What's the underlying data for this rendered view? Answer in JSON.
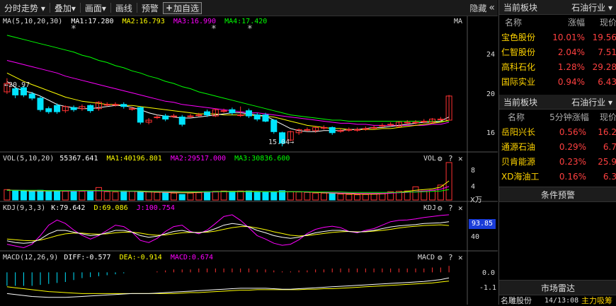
{
  "toolbar": {
    "items": [
      "分时走势 ▾",
      "叠加▾",
      "画面▾",
      "画线",
      "预警"
    ],
    "add_watch": "加自选",
    "hide_label": "隐藏",
    "hide_icon": "«"
  },
  "colors": {
    "up": "#ff3232",
    "down": "#00e4ff",
    "ma1": "#ffffff",
    "ma2": "#ffff00",
    "ma3": "#ff00ff",
    "ma4": "#00ff00"
  },
  "main_pane": {
    "legend": {
      "title": "MA(5,10,20,30)",
      "ma1": "MA1:17.280",
      "ma2": "MA2:16.793",
      "ma3": "MA3:16.990",
      "ma4": "MA4:17.420"
    },
    "corner_label": "MA",
    "high_annotation": "←20.97",
    "low_annotation": "15.04→",
    "y_ticks": [
      "24",
      "20",
      "16"
    ]
  },
  "vol_pane": {
    "legend": {
      "title": "VOL(5,10,20)",
      "vol": "55367.641",
      "ma1": "MA1:40196.801",
      "ma2": "MA2:29517.000",
      "ma3": "MA3:30836.600"
    },
    "corner_label": "VOL",
    "y_ticks": [
      "8",
      "4"
    ],
    "unit": "X万"
  },
  "kdj_pane": {
    "legend": {
      "title": "KDJ(9,3,3)",
      "k": "K:79.642",
      "d": "D:69.086",
      "j": "J:100.754"
    },
    "corner_label": "KDJ",
    "current": "93.85",
    "y_ticks": [
      "40"
    ]
  },
  "macd_pane": {
    "legend": {
      "title": "MACD(12,26,9)",
      "diff": "DIFF:-0.577",
      "dea": "DEA:-0.914",
      "macd": "MACD:0.674"
    },
    "corner_label": "MACD",
    "y_ticks": [
      "0.0",
      "-1.1"
    ]
  },
  "pane_icons": {
    "gear": "⚙",
    "help": "?",
    "close": "✕"
  },
  "chart_data": {
    "type": "candlestick",
    "candles": [
      {
        "o": 20.2,
        "c": 21.0,
        "h": 21.5,
        "l": 20.0
      },
      {
        "o": 20.5,
        "c": 19.9,
        "h": 20.7,
        "l": 19.6
      },
      {
        "o": 20.6,
        "c": 19.9,
        "h": 20.8,
        "l": 19.7
      },
      {
        "o": 20.0,
        "c": 19.6,
        "h": 20.2,
        "l": 19.4
      },
      {
        "o": 19.6,
        "c": 18.5,
        "h": 19.8,
        "l": 18.3
      },
      {
        "o": 18.6,
        "c": 18.3,
        "h": 18.8,
        "l": 18.1
      },
      {
        "o": 18.9,
        "c": 18.3,
        "h": 19.1,
        "l": 18.1
      },
      {
        "o": 18.4,
        "c": 18.8,
        "h": 18.9,
        "l": 18.2
      },
      {
        "o": 18.7,
        "c": 18.5,
        "h": 18.9,
        "l": 18.3
      },
      {
        "o": 18.6,
        "c": 18.8,
        "h": 19.0,
        "l": 18.4
      },
      {
        "o": 18.9,
        "c": 18.4,
        "h": 19.0,
        "l": 18.2
      },
      {
        "o": 18.6,
        "c": 19.2,
        "h": 19.3,
        "l": 18.4
      },
      {
        "o": 19.0,
        "c": 19.0,
        "h": 19.2,
        "l": 18.8
      },
      {
        "o": 19.0,
        "c": 19.0,
        "h": 19.2,
        "l": 18.8
      },
      {
        "o": 19.0,
        "c": 18.8,
        "h": 19.2,
        "l": 18.6
      },
      {
        "o": 18.6,
        "c": 18.6,
        "h": 18.8,
        "l": 18.4
      },
      {
        "o": 18.7,
        "c": 17.3,
        "h": 18.8,
        "l": 17.1
      },
      {
        "o": 17.3,
        "c": 17.5,
        "h": 17.7,
        "l": 17.1
      },
      {
        "o": 17.8,
        "c": 17.8,
        "h": 18.0,
        "l": 17.6
      },
      {
        "o": 17.9,
        "c": 17.6,
        "h": 18.1,
        "l": 17.4
      },
      {
        "o": 17.9,
        "c": 17.9,
        "h": 18.1,
        "l": 17.7
      },
      {
        "o": 17.8,
        "c": 17.1,
        "h": 18.0,
        "l": 16.9
      },
      {
        "o": 17.9,
        "c": 17.9,
        "h": 18.1,
        "l": 17.7
      },
      {
        "o": 18.0,
        "c": 18.0,
        "h": 18.2,
        "l": 17.8
      },
      {
        "o": 18.3,
        "c": 18.0,
        "h": 18.5,
        "l": 17.8
      },
      {
        "o": 17.9,
        "c": 18.5,
        "h": 18.6,
        "l": 17.8
      },
      {
        "o": 18.4,
        "c": 18.4,
        "h": 18.6,
        "l": 18.2
      },
      {
        "o": 18.5,
        "c": 18.2,
        "h": 18.7,
        "l": 18.0
      },
      {
        "o": 18.0,
        "c": 18.0,
        "h": 18.8,
        "l": 17.8
      },
      {
        "o": 18.4,
        "c": 17.9,
        "h": 18.6,
        "l": 17.7
      },
      {
        "o": 18.0,
        "c": 17.6,
        "h": 18.2,
        "l": 17.4
      },
      {
        "o": 18.0,
        "c": 17.4,
        "h": 18.2,
        "l": 17.3
      },
      {
        "o": 17.5,
        "c": 16.4,
        "h": 17.6,
        "l": 16.2
      },
      {
        "o": 16.3,
        "c": 15.3,
        "h": 16.4,
        "l": 15.0
      },
      {
        "o": 15.6,
        "c": 16.4,
        "h": 16.5,
        "l": 15.5
      },
      {
        "o": 16.3,
        "c": 16.6,
        "h": 16.7,
        "l": 16.1
      },
      {
        "o": 16.6,
        "c": 16.6,
        "h": 16.8,
        "l": 16.4
      },
      {
        "o": 16.5,
        "c": 16.8,
        "h": 16.9,
        "l": 16.3
      },
      {
        "o": 16.8,
        "c": 16.8,
        "h": 17.0,
        "l": 16.6
      },
      {
        "o": 16.8,
        "c": 16.3,
        "h": 16.9,
        "l": 16.1
      },
      {
        "o": 16.5,
        "c": 16.5,
        "h": 16.7,
        "l": 16.3
      },
      {
        "o": 16.6,
        "c": 16.6,
        "h": 16.8,
        "l": 16.4
      },
      {
        "o": 16.6,
        "c": 16.6,
        "h": 16.8,
        "l": 16.4
      },
      {
        "o": 16.7,
        "c": 16.7,
        "h": 16.9,
        "l": 16.5
      },
      {
        "o": 16.8,
        "c": 16.8,
        "h": 17.0,
        "l": 16.6
      },
      {
        "o": 17.0,
        "c": 17.0,
        "h": 17.2,
        "l": 16.8
      },
      {
        "o": 17.1,
        "c": 17.1,
        "h": 17.3,
        "l": 16.9
      },
      {
        "o": 16.9,
        "c": 17.3,
        "h": 17.4,
        "l": 16.8
      },
      {
        "o": 17.3,
        "c": 17.3,
        "h": 17.5,
        "l": 17.1
      },
      {
        "o": 17.3,
        "c": 17.3,
        "h": 17.5,
        "l": 17.1
      },
      {
        "o": 17.4,
        "c": 17.4,
        "h": 17.6,
        "l": 17.2
      },
      {
        "o": 17.3,
        "c": 17.6,
        "h": 17.7,
        "l": 17.2
      },
      {
        "o": 17.6,
        "c": 17.6,
        "h": 17.8,
        "l": 17.4
      },
      {
        "o": 17.5,
        "c": 19.8,
        "h": 19.9,
        "l": 17.5
      }
    ],
    "ma": {
      "ma1": [
        21.2,
        20.6,
        20.3,
        20.1,
        19.8,
        19.4,
        19.0,
        18.8,
        18.7,
        18.6,
        18.6,
        18.7,
        18.8,
        18.9,
        18.9,
        18.7,
        18.5,
        18.2,
        18.0,
        17.9,
        17.8,
        17.7,
        17.7,
        17.8,
        17.9,
        18.0,
        18.1,
        18.2,
        18.2,
        18.1,
        18.0,
        17.9,
        17.5,
        17.1,
        16.7,
        16.5,
        16.4,
        16.4,
        16.5,
        16.5,
        16.5,
        16.6,
        16.6,
        16.7,
        16.8,
        16.8,
        16.9,
        17.0,
        17.1,
        17.2,
        17.3,
        17.3,
        17.4,
        17.8
      ],
      "ma2": [
        22.0,
        21.6,
        21.2,
        20.9,
        20.6,
        20.3,
        20.0,
        19.7,
        19.5,
        19.3,
        19.2,
        19.1,
        19.0,
        19.0,
        18.9,
        18.9,
        18.8,
        18.7,
        18.6,
        18.5,
        18.4,
        18.3,
        18.2,
        18.1,
        18.1,
        18.1,
        18.0,
        18.0,
        18.0,
        18.0,
        17.9,
        17.9,
        17.8,
        17.6,
        17.4,
        17.2,
        17.0,
        16.9,
        16.8,
        16.7,
        16.7,
        16.6,
        16.6,
        16.6,
        16.6,
        16.7,
        16.7,
        16.8,
        16.9,
        17.0,
        17.1,
        17.2,
        17.3,
        17.5
      ],
      "ma3": [
        23.2,
        23.0,
        22.8,
        22.6,
        22.4,
        22.2,
        22.0,
        21.7,
        21.5,
        21.3,
        21.1,
        20.9,
        20.7,
        20.5,
        20.3,
        20.1,
        19.9,
        19.7,
        19.5,
        19.3,
        19.2,
        19.0,
        18.9,
        18.8,
        18.7,
        18.6,
        18.5,
        18.4,
        18.3,
        18.2,
        18.2,
        18.1,
        18.0,
        17.9,
        17.8,
        17.7,
        17.6,
        17.5,
        17.4,
        17.3,
        17.2,
        17.2,
        17.1,
        17.1,
        17.0,
        17.0,
        17.0,
        17.0,
        17.0,
        17.0,
        17.0,
        17.1,
        17.1,
        17.3
      ],
      "ma4": [
        25.6,
        25.4,
        25.2,
        25.0,
        24.8,
        24.6,
        24.4,
        24.2,
        24.0,
        23.7,
        23.5,
        23.2,
        23.0,
        22.7,
        22.5,
        22.2,
        22.0,
        21.7,
        21.5,
        21.2,
        21.0,
        20.7,
        20.5,
        20.2,
        20.0,
        19.8,
        19.6,
        19.4,
        19.2,
        19.0,
        18.8,
        18.6,
        18.4,
        18.2,
        18.0,
        17.9,
        17.8,
        17.7,
        17.6,
        17.5,
        17.5,
        17.4,
        17.4,
        17.4,
        17.4,
        17.4,
        17.4,
        17.4,
        17.4,
        17.4,
        17.4,
        17.4,
        17.4,
        17.4
      ]
    },
    "ylim": [
      14.6,
      26.2
    ],
    "volume": [
      3.0,
      2.8,
      2.7,
      2.6,
      2.8,
      2.4,
      2.6,
      2.5,
      2.4,
      2.5,
      2.6,
      3.6,
      2.4,
      2.3,
      2.6,
      2.5,
      2.3,
      2.5,
      2.2,
      2.1,
      2.0,
      1.6,
      2.0,
      2.1,
      2.4,
      2.5,
      2.6,
      2.5,
      2.6,
      2.6,
      2.3,
      2.4,
      2.3,
      2.7,
      2.4,
      2.3,
      2.2,
      2.0,
      2.0,
      1.8,
      1.7,
      1.6,
      1.5,
      1.6,
      1.7,
      1.8,
      2.4,
      2.5,
      2.6,
      3.8,
      2.6,
      2.8,
      4.3,
      10.8
    ],
    "vol_ma": {
      "ma1": [
        2.9,
        2.8,
        2.7,
        2.6,
        2.6,
        2.6,
        2.6,
        2.6,
        2.6,
        2.7,
        2.7,
        2.7,
        2.6,
        2.6,
        2.5,
        2.5,
        2.4,
        2.3,
        2.3,
        2.2,
        2.1,
        2.1,
        2.1,
        2.2,
        2.3,
        2.4,
        2.5,
        2.5,
        2.5,
        2.5,
        2.5,
        2.4,
        2.4,
        2.4,
        2.4,
        2.4,
        2.3,
        2.2,
        2.1,
        2.0,
        1.9,
        1.8,
        1.7,
        1.7,
        1.7,
        1.8,
        2.0,
        2.2,
        2.5,
        2.8,
        3.0,
        3.2,
        3.7,
        5.5
      ],
      "ma2": [
        2.8,
        2.8,
        2.8,
        2.7,
        2.7,
        2.7,
        2.7,
        2.6,
        2.6,
        2.6,
        2.6,
        2.6,
        2.6,
        2.6,
        2.5,
        2.5,
        2.5,
        2.4,
        2.4,
        2.3,
        2.3,
        2.3,
        2.3,
        2.3,
        2.3,
        2.3,
        2.4,
        2.4,
        2.4,
        2.4,
        2.4,
        2.4,
        2.4,
        2.4,
        2.4,
        2.4,
        2.3,
        2.3,
        2.2,
        2.1,
        2.0,
        2.0,
        1.9,
        1.9,
        1.9,
        1.9,
        2.0,
        2.1,
        2.2,
        2.4,
        2.6,
        2.8,
        3.1,
        3.9
      ],
      "ma3": [
        2.8,
        2.8,
        2.8,
        2.8,
        2.8,
        2.7,
        2.7,
        2.7,
        2.7,
        2.7,
        2.7,
        2.7,
        2.7,
        2.6,
        2.6,
        2.6,
        2.6,
        2.5,
        2.5,
        2.5,
        2.5,
        2.4,
        2.4,
        2.4,
        2.4,
        2.4,
        2.4,
        2.4,
        2.4,
        2.4,
        2.4,
        2.4,
        2.4,
        2.4,
        2.4,
        2.4,
        2.4,
        2.3,
        2.3,
        2.3,
        2.3,
        2.2,
        2.2,
        2.2,
        2.2,
        2.2,
        2.2,
        2.2,
        2.3,
        2.3,
        2.4,
        2.5,
        2.6,
        3.0
      ]
    },
    "vol_ylim": [
      0,
      11
    ],
    "kdj": {
      "k": [
        25,
        20,
        18,
        20,
        30,
        45,
        55,
        55,
        50,
        45,
        40,
        42,
        48,
        55,
        55,
        50,
        40,
        35,
        38,
        45,
        52,
        55,
        50,
        48,
        52,
        60,
        70,
        75,
        72,
        65,
        55,
        48,
        40,
        35,
        32,
        35,
        42,
        48,
        52,
        55,
        55,
        52,
        50,
        52,
        55,
        60,
        65,
        68,
        70,
        72,
        75,
        76,
        77,
        80
      ],
      "d": [
        30,
        28,
        26,
        25,
        27,
        33,
        40,
        45,
        47,
        47,
        45,
        44,
        45,
        48,
        50,
        50,
        47,
        43,
        41,
        42,
        45,
        48,
        49,
        49,
        50,
        53,
        58,
        63,
        66,
        66,
        62,
        57,
        51,
        46,
        41,
        39,
        40,
        43,
        46,
        49,
        51,
        52,
        51,
        51,
        53,
        55,
        58,
        62,
        65,
        67,
        69,
        70,
        71,
        69
      ],
      "j": [
        15,
        10,
        5,
        15,
        40,
        70,
        85,
        75,
        56,
        41,
        30,
        40,
        55,
        70,
        66,
        50,
        26,
        20,
        32,
        52,
        66,
        70,
        52,
        45,
        56,
        75,
        95,
        100,
        84,
        63,
        40,
        30,
        18,
        12,
        15,
        28,
        46,
        58,
        64,
        67,
        63,
        52,
        48,
        55,
        60,
        70,
        80,
        84,
        85,
        88,
        92,
        95,
        98,
        100
      ]
    },
    "kdj_ylim": [
      0,
      110
    ],
    "macd": {
      "diff": [
        -2.2,
        -2.3,
        -2.4,
        -2.5,
        -2.55,
        -2.6,
        -2.6,
        -2.6,
        -2.55,
        -2.5,
        -2.45,
        -2.4,
        -2.35,
        -2.3,
        -2.25,
        -2.2,
        -2.2,
        -2.2,
        -2.15,
        -2.1,
        -2.05,
        -2.0,
        -1.95,
        -1.9,
        -1.85,
        -1.8,
        -1.75,
        -1.7,
        -1.65,
        -1.65,
        -1.65,
        -1.65,
        -1.7,
        -1.75,
        -1.75,
        -1.7,
        -1.65,
        -1.6,
        -1.55,
        -1.5,
        -1.45,
        -1.4,
        -1.35,
        -1.3,
        -1.25,
        -1.2,
        -1.15,
        -1.1,
        -1.05,
        -1.0,
        -0.95,
        -0.85,
        -0.75,
        -0.58
      ],
      "dea": [
        -1.5,
        -1.6,
        -1.7,
        -1.8,
        -1.9,
        -2.0,
        -2.05,
        -2.1,
        -2.15,
        -2.2,
        -2.2,
        -2.2,
        -2.2,
        -2.2,
        -2.2,
        -2.2,
        -2.2,
        -2.2,
        -2.2,
        -2.2,
        -2.2,
        -2.15,
        -2.1,
        -2.1,
        -2.05,
        -2.0,
        -1.95,
        -1.9,
        -1.85,
        -1.85,
        -1.8,
        -1.8,
        -1.8,
        -1.8,
        -1.8,
        -1.8,
        -1.75,
        -1.75,
        -1.7,
        -1.7,
        -1.65,
        -1.6,
        -1.55,
        -1.5,
        -1.45,
        -1.4,
        -1.35,
        -1.3,
        -1.25,
        -1.2,
        -1.15,
        -1.1,
        -1.0,
        -0.91
      ],
      "hist": [
        -1.4,
        -1.4,
        -1.4,
        -1.4,
        -1.3,
        -1.2,
        -1.1,
        -1.0,
        -0.8,
        -0.6,
        -0.5,
        -0.4,
        -0.3,
        -0.2,
        -0.1,
        0.0,
        0.0,
        0.0,
        0.1,
        0.2,
        0.3,
        0.3,
        0.3,
        0.4,
        0.4,
        0.4,
        0.4,
        0.4,
        0.4,
        0.4,
        0.3,
        0.3,
        0.2,
        0.1,
        0.1,
        0.2,
        0.2,
        0.3,
        0.3,
        0.4,
        0.4,
        0.4,
        0.4,
        0.4,
        0.4,
        0.4,
        0.4,
        0.4,
        0.4,
        0.4,
        0.4,
        0.5,
        0.5,
        0.67
      ]
    },
    "macd_ylim": [
      -3.2,
      1.2
    ]
  },
  "sidebar": {
    "panel1": {
      "title": "当前板块",
      "sector": "石油行业 ▾",
      "headers": [
        "名称",
        "涨幅",
        "现价"
      ],
      "rows": [
        {
          "name": "宝色股份",
          "pct": "10.01%",
          "price": "19.56"
        },
        {
          "name": "仁智股份",
          "pct": "2.04%",
          "price": "7.51"
        },
        {
          "name": "高科石化",
          "pct": "1.28%",
          "price": "29.28"
        },
        {
          "name": "国际实业",
          "pct": "0.94%",
          "price": "6.43"
        }
      ]
    },
    "panel2": {
      "title": "当前板块",
      "sector": "石油行业 ▾",
      "headers": [
        "名称",
        "5分钟涨幅",
        "现价"
      ],
      "rows": [
        {
          "name": "岳阳兴长",
          "pct": "0.56%",
          "price": "16.2"
        },
        {
          "name": "通源石油",
          "pct": "0.29%",
          "price": "6.7"
        },
        {
          "name": "贝肯能源",
          "pct": "0.23%",
          "price": "25.9"
        },
        {
          "name": "XD海油工",
          "pct": "0.16%",
          "price": "6.3"
        }
      ]
    },
    "cond_alert": "条件预警",
    "market_radar": "市场雷达",
    "radar_item": {
      "name": "名雕股份",
      "time": "14/13:08",
      "text": "主力吸筹"
    }
  }
}
